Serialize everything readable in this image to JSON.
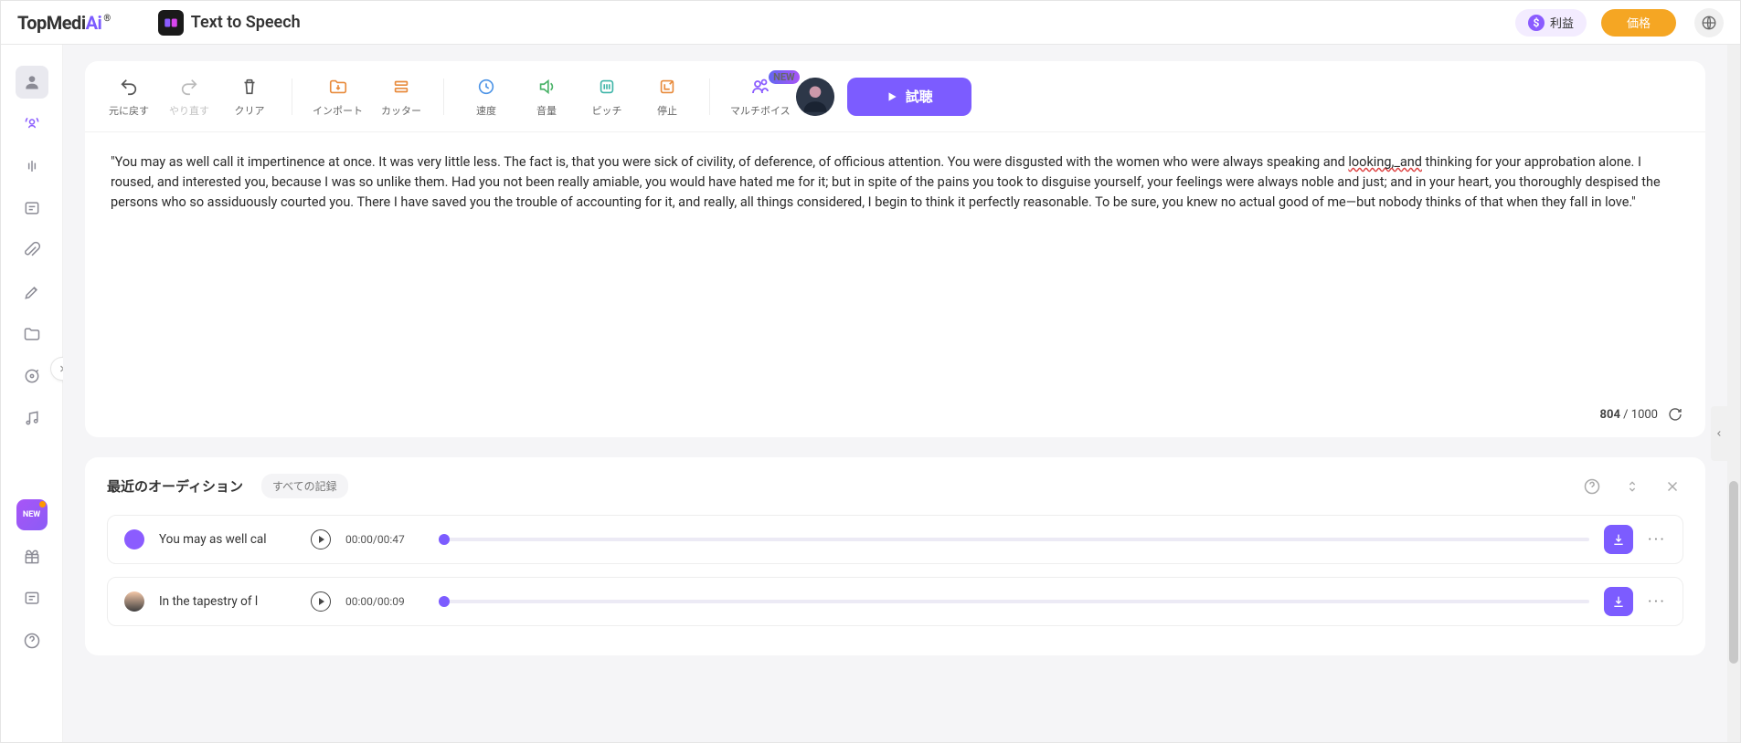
{
  "header": {
    "logo_a": "TopMedi",
    "logo_b": "Ai",
    "module": "Text to Speech",
    "profit": "利益",
    "price": "価格"
  },
  "toolbar": {
    "undo": "元に戻す",
    "redo": "やり直す",
    "clear": "クリア",
    "import": "インポート",
    "cutter": "カッター",
    "speed": "速度",
    "volume": "音量",
    "pitch": "ピッチ",
    "stop": "停止",
    "multivoice": "マルチボイス",
    "new": "NEW",
    "play": "試聴"
  },
  "editor": {
    "text_pre": "\"You may as well call it impertinence at once. It was very little less. The fact is, that you were sick of civility, of deference, of officious attention. You were disgusted with the women who were always speaking and ",
    "text_spell": "looking,_and",
    "text_post": " thinking for your approbation alone. I roused, and interested you, because I was so unlike them. Had you not been really amiable, you would have hated me for it; but in spite of the pains you took to disguise yourself, your feelings were always noble and just; and in your heart, you thoroughly despised the persons who so assiduously courted you. There I have saved you the trouble of accounting for it, and really, all things considered, I begin to think it perfectly reasonable. To be sure, you knew no actual good of me—but nobody thinks of that when they fall in love.\"",
    "count": "804",
    "max": "/ 1000"
  },
  "history": {
    "title": "最近のオーディション",
    "all": "すべての記録",
    "rows": [
      {
        "name": "You may as well cal",
        "time": "00:00/00:47"
      },
      {
        "name": "In the tapestry of l",
        "time": "00:00/00:09"
      }
    ]
  }
}
